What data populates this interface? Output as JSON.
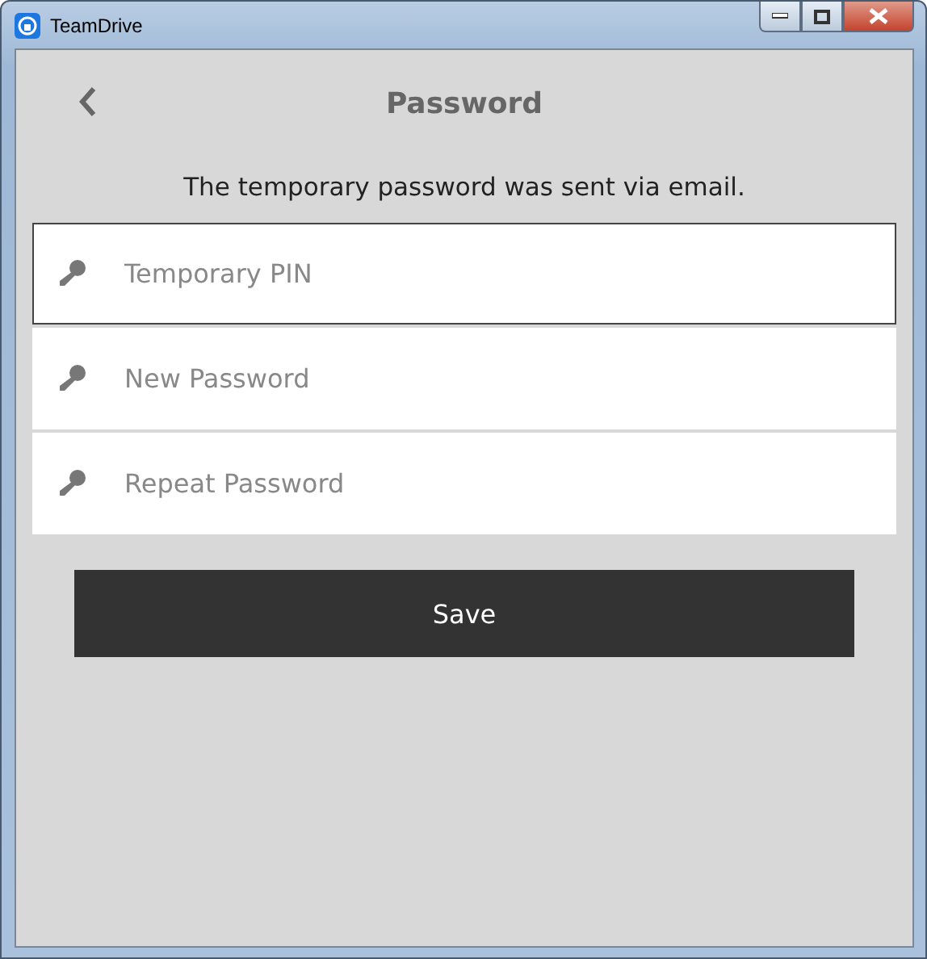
{
  "window": {
    "title": "TeamDrive"
  },
  "header": {
    "title": "Password"
  },
  "message": "The temporary password was sent via email.",
  "fields": [
    {
      "placeholder": "Temporary PIN",
      "focused": true
    },
    {
      "placeholder": "New Password",
      "focused": false
    },
    {
      "placeholder": "Repeat Password",
      "focused": false
    }
  ],
  "buttons": [
    {
      "label": "Save"
    }
  ]
}
